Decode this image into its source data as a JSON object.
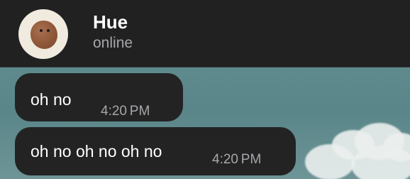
{
  "contact": {
    "name": "Hue",
    "status": "online",
    "avatar_icon": "cookie-avatar"
  },
  "messages": [
    {
      "text": "oh no",
      "time": "4:20 PM"
    },
    {
      "text": "oh no oh no oh no",
      "time": "4:20 PM"
    }
  ],
  "colors": {
    "header_bg": "#212122",
    "bubble_bg": "#232324",
    "chat_bg": "#5e8a8d",
    "name_text": "#ffffff",
    "muted_text": "#a7a7ab"
  }
}
